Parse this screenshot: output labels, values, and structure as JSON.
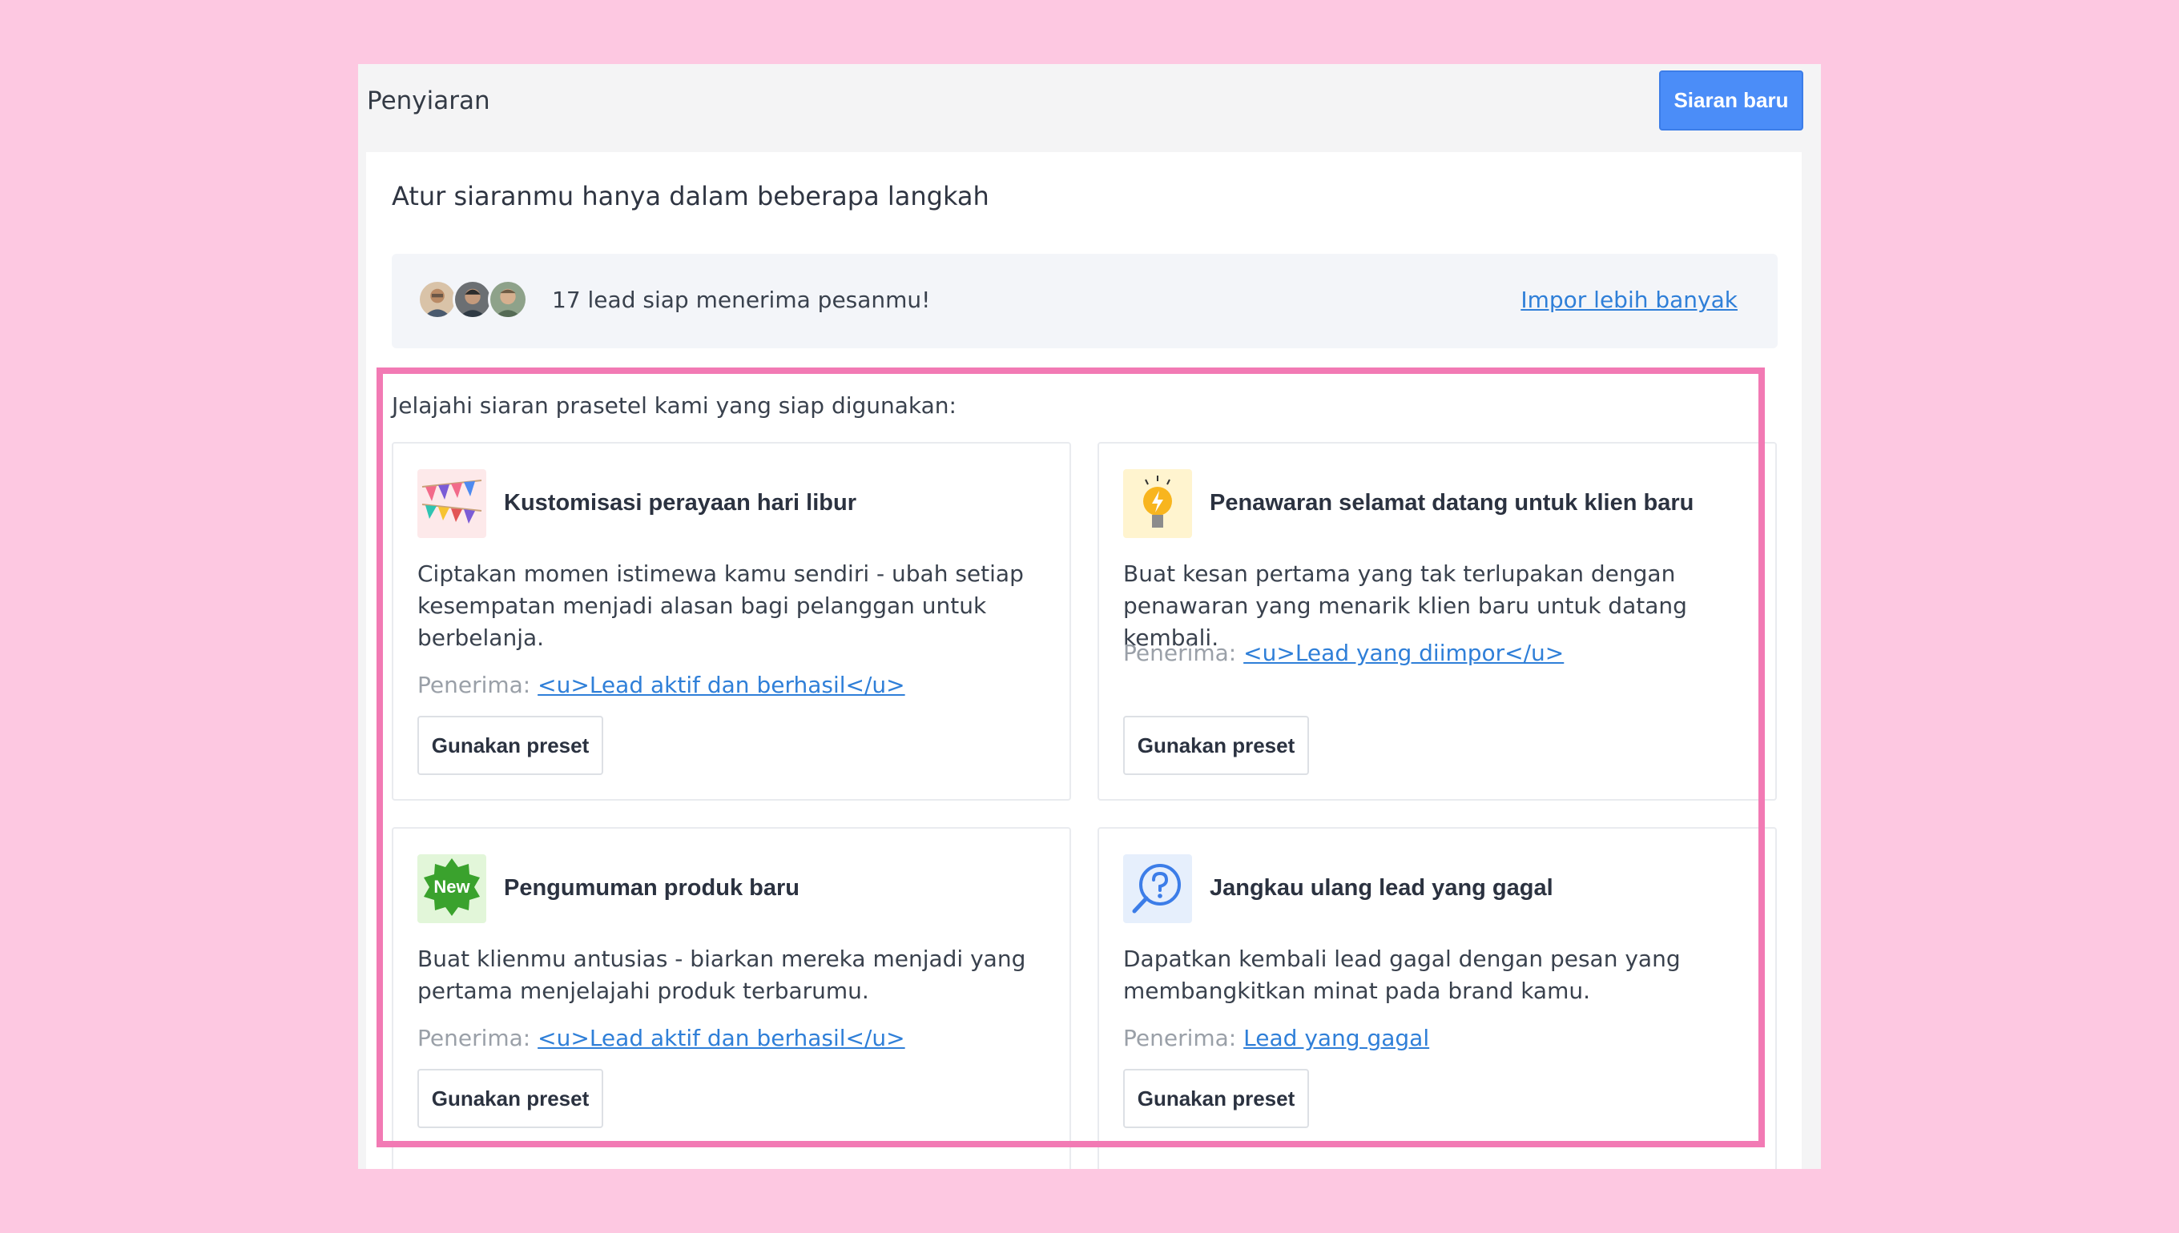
{
  "header": {
    "title": "Penyiaran",
    "new_button": "Siaran baru"
  },
  "panel": {
    "heading": "Atur siaranmu hanya dalam beberapa langkah",
    "leads": {
      "text": "17 lead siap menerima pesanmu!",
      "import_link": "Impor lebih banyak",
      "avatars": [
        "avatar-1",
        "avatar-2",
        "avatar-3"
      ]
    },
    "intro": "Jelajahi siaran prasetel kami yang siap digunakan:",
    "recipient_label": "Penerima:",
    "cards": [
      {
        "icon": "bunting-flags-icon",
        "title": "Kustomisasi perayaan hari libur",
        "description": "Ciptakan momen istimewa kamu sendiri - ubah setiap kesempatan menjadi alasan bagi pelanggan untuk berbelanja.",
        "recipient": "<u>Lead aktif dan berhasil</u>",
        "button": "Gunakan preset"
      },
      {
        "icon": "lightbulb-icon",
        "title": "Penawaran selamat datang untuk klien baru",
        "description": "Buat kesan pertama yang tak terlupakan dengan penawaran yang menarik klien baru untuk datang kembali.",
        "recipient": "<u>Lead yang diimpor</u>",
        "button": "Gunakan preset"
      },
      {
        "icon": "new-badge-icon",
        "icon_text": "New",
        "title": "Pengumuman produk baru",
        "description": "Buat klienmu antusias - biarkan mereka menjadi yang pertama menjelajahi produk terbarumu.",
        "recipient": "<u>Lead aktif dan berhasil</u>",
        "button": "Gunakan preset"
      },
      {
        "icon": "search-question-icon",
        "title": "Jangkau ulang lead yang gagal",
        "description": "Dapatkan kembali lead gagal dengan pesan yang membangkitkan minat pada brand kamu.",
        "recipient": "Lead yang gagal",
        "button": "Gunakan preset"
      }
    ]
  },
  "colors": {
    "background": "#fdc8e1",
    "primary_button": "#4b8df8",
    "link": "#2f7fd8",
    "highlight": "#f27ab4"
  }
}
